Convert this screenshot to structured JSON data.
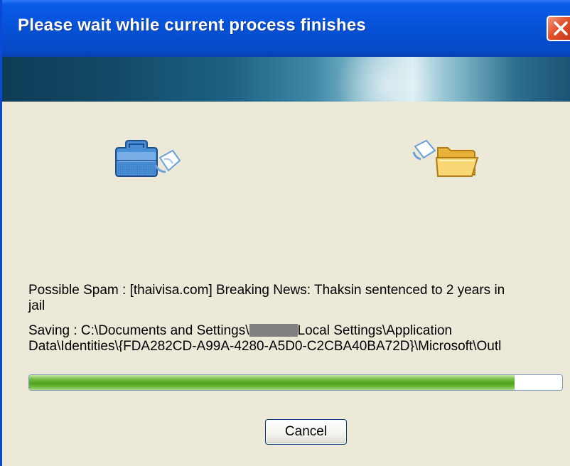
{
  "window": {
    "title": "Please wait while current process finishes",
    "close_icon": "close-icon",
    "title_bar_color": "#0652d6",
    "close_button_color": "#e0502b"
  },
  "icons": {
    "source": "briefcase-document-icon",
    "destination": "open-folder-icon"
  },
  "status": {
    "message_line1": "Possible Spam : [thaivisa.com] Breaking News: Thaksin sentenced to 2 years in",
    "message_line2": "jail",
    "saving_prefix": "Saving : C:\\Documents and Settings\\",
    "saving_suffix": "Local Settings\\Application",
    "saving_line2": "Data\\Identities\\{FDA282CD-A99A-4280-A5D0-C2CBA40BA72D}\\Microsoft\\Outl"
  },
  "progress": {
    "percent": 91,
    "fill_color": "#4ea21e"
  },
  "buttons": {
    "cancel_label": "Cancel"
  }
}
